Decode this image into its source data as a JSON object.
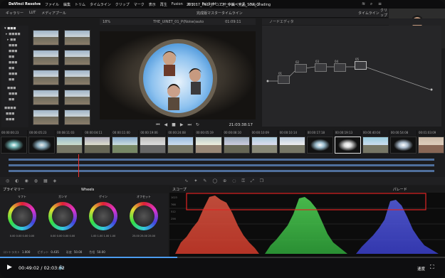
{
  "menubar": {
    "app_name": "DaVinci Resolve",
    "menus": [
      "ファイル",
      "編集",
      "トリム",
      "タイムライン",
      "クリップ",
      "マーク",
      "表示",
      "再生",
      "Fusion",
      "カラー",
      "Fairlight",
      "ワークスペース",
      "ヘルプ"
    ],
    "project_title": "201117_HuLi_テコエボ_中編・完品_SDR_Grading"
  },
  "toolbar": {
    "left_items": [
      "ギャラリー",
      "LUT",
      "メディアプール"
    ],
    "center_label": "完成版マスタータイムライン",
    "right_items": [
      "タイムライン",
      "クリップ"
    ]
  },
  "viewer": {
    "clip_name": "THE_UINET_01_P(Noise)auto",
    "zoom": "18%",
    "timecode_top": "01:09:11",
    "timecode": "21:03:38:17",
    "node_label": "ノードエディタ"
  },
  "clip_timecodes": [
    "00:00:00:23",
    "00:00:05:23",
    "00:08:11:03",
    "00:00:04:11",
    "00:00:11:00",
    "00:00:19:06",
    "00:00:24:08",
    "00:00:05:19",
    "00:00:08:10",
    "00:00:10:09",
    "00:00:10:14",
    "00:00:17:18",
    "00:00:19:13",
    "00:00:40:04",
    "00:00:54:08",
    "00:01:03:09"
  ],
  "node_graph": {
    "nodes": [
      "01",
      "02",
      "03",
      "04",
      "05"
    ]
  },
  "color_toolbar": {
    "primary_label": "プライマリー",
    "mode_label": "Wheels",
    "scope_label": "スコープ",
    "parade_label": "パレード"
  },
  "wheels": [
    {
      "name": "リフト",
      "values": "0.00  0.00  0.00  0.00"
    },
    {
      "name": "ガンマ",
      "values": "0.00  0.00  0.00  0.00"
    },
    {
      "name": "ゲイン",
      "values": "1.00  1.00  1.00  1.00"
    },
    {
      "name": "オフセット",
      "values": "25.00 25.00 25.00"
    }
  ],
  "wheel_params": {
    "contrast_label": "コントラスト",
    "contrast_value": "1.000",
    "pivot_label": "ピボット",
    "pivot_value": "0.435",
    "saturation_label": "彩度",
    "saturation_value": "50.00",
    "hue_label": "色相",
    "hue_value": "50.00"
  },
  "scope_scale": [
    "1023",
    "896",
    "768",
    "640",
    "512",
    "384",
    "256",
    "128",
    "0"
  ],
  "playback": {
    "current_time": "00:49:02",
    "duration": "02:03:02",
    "progress_fraction": 0.398,
    "speed_label": "速度"
  },
  "webcam": {
    "name": "jun ota"
  },
  "colors": {
    "accent_blue": "#4c9cf0",
    "highlight_red": "#e02525"
  }
}
